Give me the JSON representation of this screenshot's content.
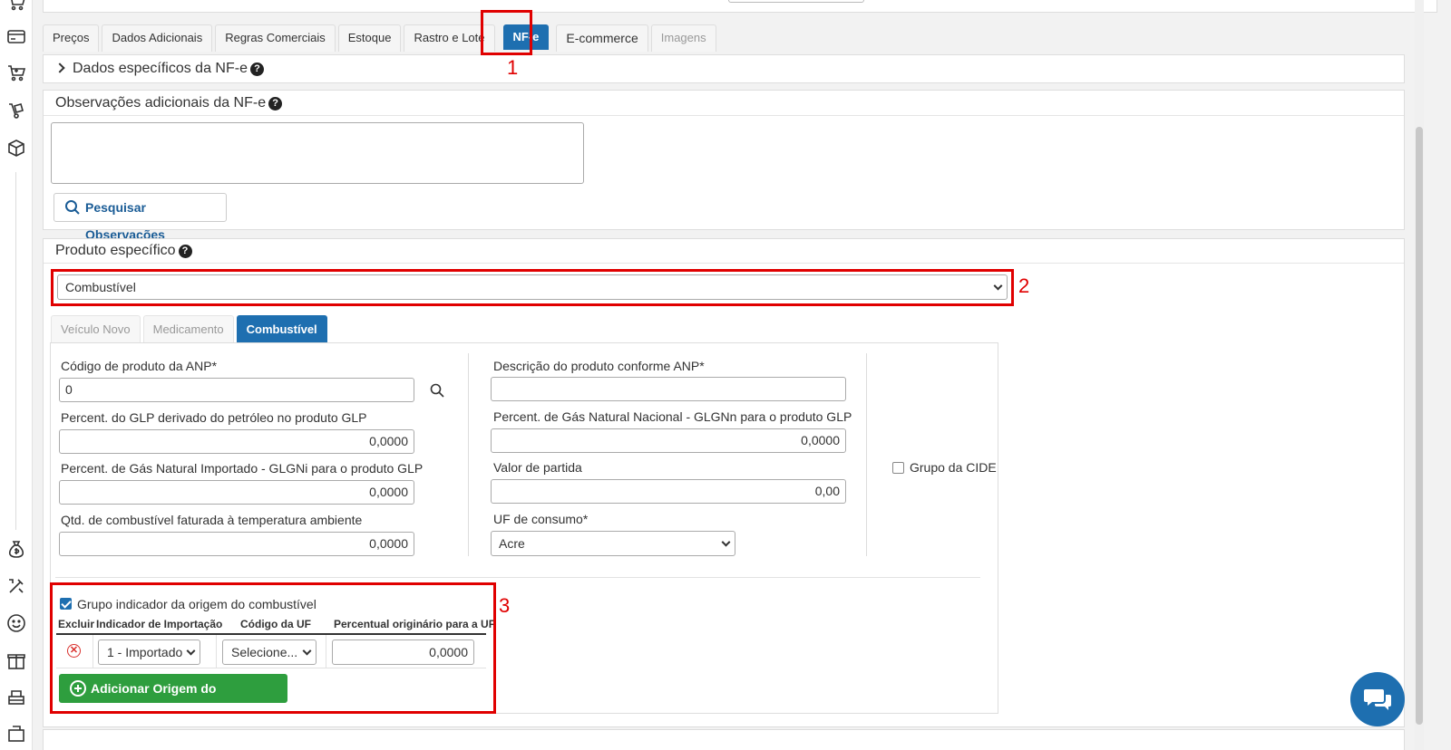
{
  "tabs": [
    {
      "label": "Preços"
    },
    {
      "label": "Dados Adicionais"
    },
    {
      "label": "Regras Comerciais"
    },
    {
      "label": "Estoque"
    },
    {
      "label": "Rastro e Lote"
    },
    {
      "label": "NF-e",
      "active": true
    },
    {
      "label": "E-commerce"
    },
    {
      "label": "Imagens",
      "disabled": true
    }
  ],
  "nfe_specific": {
    "label": "Dados específicos da NF-e"
  },
  "observacoes": {
    "title": "Observações adicionais da NF-e",
    "value": "",
    "search_button": "Pesquisar Observações"
  },
  "produto_especifico": {
    "title": "Produto específico",
    "selected": "Combustível"
  },
  "subtabs": [
    {
      "label": "Veículo Novo"
    },
    {
      "label": "Medicamento"
    },
    {
      "label": "Combustível",
      "active": true
    }
  ],
  "combustivel": {
    "codigo_anp": {
      "label": "Código de produto da ANP*",
      "value": "0"
    },
    "descricao_anp": {
      "label": "Descrição do produto conforme ANP*",
      "value": ""
    },
    "perc_glp": {
      "label": "Percent. do GLP derivado do petróleo no produto GLP",
      "value": "0,0000"
    },
    "perc_glgnn": {
      "label": "Percent. de Gás Natural Nacional - GLGNn para o produto GLP",
      "value": "0,0000"
    },
    "perc_glgni": {
      "label": "Percent. de Gás Natural Importado - GLGNi para o produto GLP",
      "value": "0,0000"
    },
    "valor_partida": {
      "label": "Valor de partida",
      "value": "0,00"
    },
    "qtd_temp": {
      "label": "Qtd. de combustível faturada à temperatura ambiente",
      "value": "0,0000"
    },
    "uf_consumo": {
      "label": "UF de consumo*",
      "value": "Acre"
    },
    "grupo_cide": {
      "label": "Grupo da CIDE",
      "checked": false
    }
  },
  "origem": {
    "group_label": "Grupo indicador da origem do combustível",
    "checked": true,
    "headers": {
      "excluir": "Excluir",
      "indicador": "Indicador de Importação",
      "codigo_uf": "Código da UF",
      "percentual": "Percentual originário para a UF"
    },
    "row": {
      "indicador": "1 - Importado",
      "codigo_uf": "Selecione...",
      "percentual": "0,0000"
    },
    "add_button": "Adicionar Origem do Combustível"
  },
  "annotations": [
    "1",
    "2",
    "3"
  ],
  "colors": {
    "accent": "#1e6fb0",
    "success": "#2e9e3e",
    "highlight": "#e00000",
    "remove": "#d9302c"
  }
}
